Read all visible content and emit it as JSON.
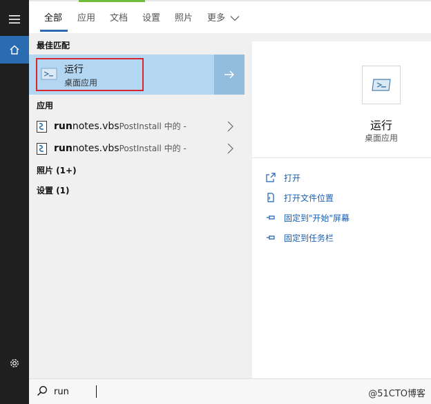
{
  "tabs": [
    {
      "label": "全部",
      "active": true
    },
    {
      "label": "应用"
    },
    {
      "label": "文档"
    },
    {
      "label": "设置"
    },
    {
      "label": "照片"
    },
    {
      "label": "更多"
    }
  ],
  "sections": {
    "best_match": "最佳匹配",
    "apps": "应用",
    "photos": "照片 (1+)",
    "settings": "设置 (1)"
  },
  "best_match": {
    "title": "运行",
    "subtitle": "桌面应用"
  },
  "app_items": [
    {
      "bold": "run",
      "rest": "notes.vbs",
      "context": "PostInstall 中的 -"
    },
    {
      "bold": "run",
      "rest": "notes.vbs",
      "context": "PostInstall 中的 -"
    }
  ],
  "detail": {
    "title": "运行",
    "subtitle": "桌面应用",
    "actions": [
      {
        "label": "打开",
        "icon": "open-icon"
      },
      {
        "label": "打开文件位置",
        "icon": "file-location-icon"
      },
      {
        "label": "固定到\"开始\"屏幕",
        "icon": "pin-start-icon"
      },
      {
        "label": "固定到任务栏",
        "icon": "pin-taskbar-icon"
      }
    ]
  },
  "search": {
    "value": "run",
    "placeholder": ""
  },
  "watermark": "@51CTO博客",
  "colors": {
    "accent": "#2b6cb0",
    "selection": "#b3d6f2",
    "highlight_border": "#d9232d",
    "link": "#1a5fb4"
  }
}
